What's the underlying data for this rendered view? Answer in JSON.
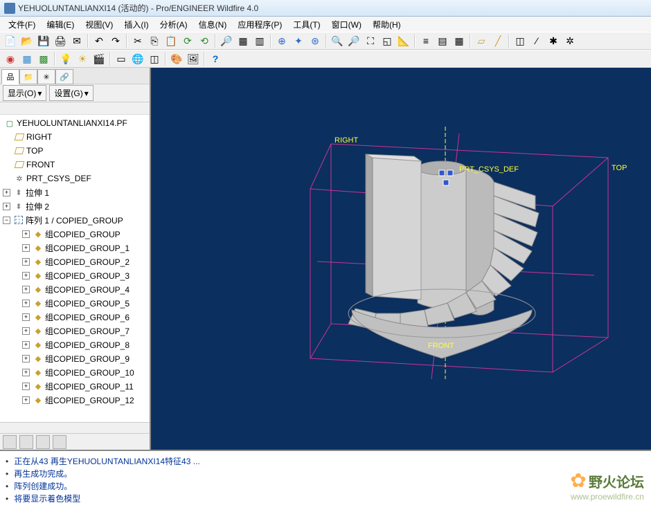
{
  "title": "YEHUOLUNTANLIANXI14 (活动的) - Pro/ENGINEER Wildfire 4.0",
  "menu": [
    "文件(F)",
    "编辑(E)",
    "视图(V)",
    "插入(I)",
    "分析(A)",
    "信息(N)",
    "应用程序(P)",
    "工具(T)",
    "窗口(W)",
    "帮助(H)"
  ],
  "sidebar": {
    "show_btn": "显示(O)",
    "settings_btn": "设置(G)",
    "root": "YEHUOLUNTANLIANXI14.PF",
    "planes": [
      "RIGHT",
      "TOP",
      "FRONT"
    ],
    "csys": "PRT_CSYS_DEF",
    "extrudes": [
      "拉伸 1",
      "拉伸 2"
    ],
    "pattern": "阵列 1 / COPIED_GROUP",
    "groups": [
      "组COPIED_GROUP",
      "组COPIED_GROUP_1",
      "组COPIED_GROUP_2",
      "组COPIED_GROUP_3",
      "组COPIED_GROUP_4",
      "组COPIED_GROUP_5",
      "组COPIED_GROUP_6",
      "组COPIED_GROUP_7",
      "组COPIED_GROUP_8",
      "组COPIED_GROUP_9",
      "组COPIED_GROUP_10",
      "组COPIED_GROUP_11",
      "组COPIED_GROUP_12"
    ]
  },
  "viewport": {
    "labels": {
      "right": "RIGHT",
      "top": "TOP",
      "front": "FRONT",
      "csys": "PRT_CSYS_DEF"
    }
  },
  "status": [
    "正在从43 再生YEHUOLUNTANLIANXI14特征43 ...",
    "再生成功完成。",
    "阵列创建成功。",
    "将要显示着色模型"
  ],
  "watermark": {
    "name": "野火论坛",
    "url": "www.proewildfire.cn"
  }
}
